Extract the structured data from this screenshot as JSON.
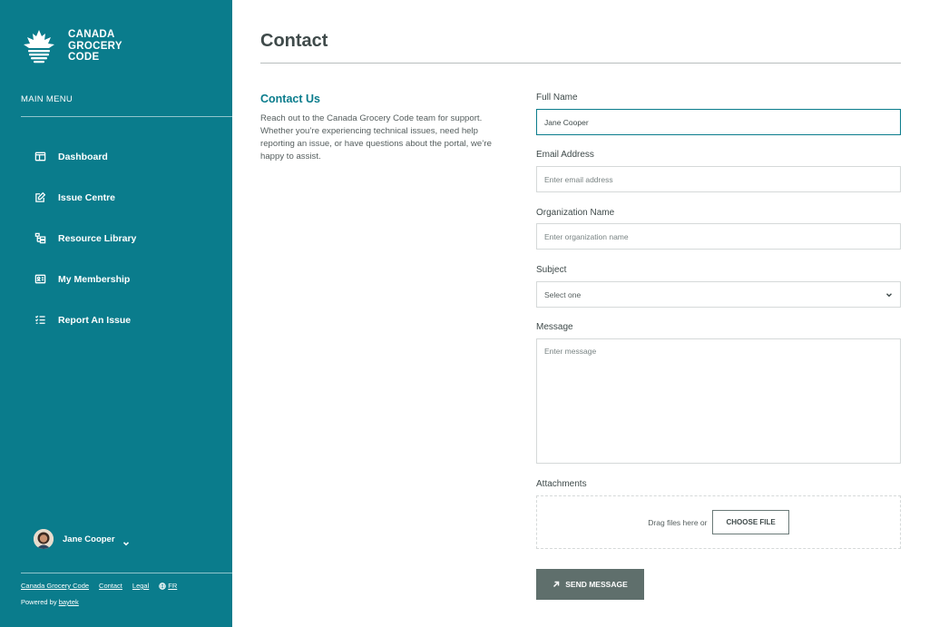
{
  "brand": {
    "name_lines": [
      "CANADA",
      "GROCERY",
      "CODE"
    ],
    "logo_icon": "maple-leaf-basket-icon",
    "primary_color": "#0a7c8c",
    "button_color": "#5f6f6c"
  },
  "sidebar": {
    "menu_heading": "MAIN MENU",
    "items": [
      {
        "label": "Dashboard",
        "icon": "layout-icon"
      },
      {
        "label": "Issue Centre",
        "icon": "edit-icon"
      },
      {
        "label": "Resource Library",
        "icon": "folder-tree-icon"
      },
      {
        "label": "My Membership",
        "icon": "id-card-icon"
      },
      {
        "label": "Report An Issue",
        "icon": "list-check-icon"
      }
    ],
    "user": {
      "name": "Jane Cooper"
    },
    "footer": {
      "links": [
        "Canada Grocery Code",
        "Contact",
        "Legal"
      ],
      "language": "FR",
      "powered_by_prefix": "Powered by",
      "powered_by_link": "baytek"
    }
  },
  "main": {
    "title": "Contact",
    "contact_heading": "Contact Us",
    "contact_description": "Reach out to the Canada Grocery Code team for support. Whether you’re experiencing technical issues, need help reporting an issue, or have questions about the portal, we’re happy to assist.",
    "form": {
      "full_name": {
        "label": "Full Name",
        "value": "Jane Cooper"
      },
      "email": {
        "label": "Email Address",
        "placeholder": "Enter email address"
      },
      "organization": {
        "label": "Organization Name",
        "placeholder": "Enter organization name"
      },
      "subject": {
        "label": "Subject",
        "selected": "Select one"
      },
      "message": {
        "label": "Message",
        "placeholder": "Enter message"
      },
      "attachments": {
        "label": "Attachments",
        "drop_text": "Drag files here or",
        "choose_label": "CHOOSE FILE"
      },
      "submit_label": "SEND MESSAGE"
    }
  }
}
